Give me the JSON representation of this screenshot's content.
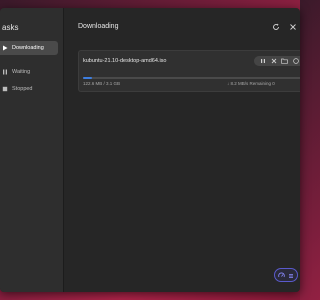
{
  "sidebar": {
    "title": "asks",
    "items": [
      {
        "label": "Downloading",
        "active": true
      },
      {
        "label": "Waiting",
        "active": false
      },
      {
        "label": "Stopped",
        "active": false
      }
    ]
  },
  "main": {
    "title": "Downloading",
    "header_icons": [
      "refresh-icon",
      "close-icon"
    ]
  },
  "task": {
    "name": "kubuntu-21.10-desktop-amd64.iso",
    "size_text": "122.6 MB / 3.1 GB",
    "speed_text": "↓ 8.2 MB/s  Remaining 0",
    "progress": 0.04,
    "actions": [
      "pause-icon",
      "close-icon",
      "folder-icon",
      "info-icon"
    ]
  },
  "colors": {
    "accent": "#3d7ee0",
    "window_bg": "#262626",
    "sidebar_bg": "#2e2e2e"
  }
}
